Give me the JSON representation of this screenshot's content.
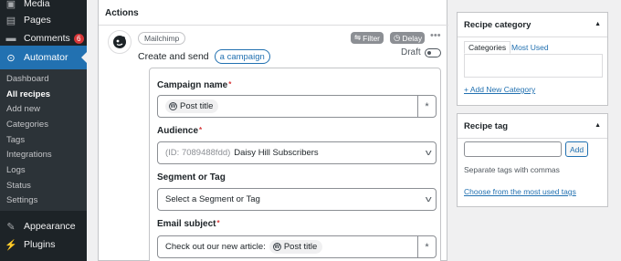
{
  "sidebar": {
    "top_items": [
      {
        "label": "Media",
        "icon": "media-icon"
      },
      {
        "label": "Pages",
        "icon": "pages-icon"
      },
      {
        "label": "Comments",
        "icon": "comments-icon",
        "badge": "6"
      },
      {
        "label": "Automator",
        "icon": "automator-icon",
        "active": true
      }
    ],
    "submenu": [
      "Dashboard",
      "All recipes",
      "Add new",
      "Categories",
      "Tags",
      "Integrations",
      "Logs",
      "Status",
      "Settings"
    ],
    "current_submenu": "All recipes",
    "bottom_items": [
      {
        "label": "Appearance",
        "icon": "appearance-icon"
      },
      {
        "label": "Plugins",
        "icon": "plugins-icon"
      }
    ]
  },
  "actions": {
    "title": "Actions",
    "integration": "Mailchimp",
    "filter_label": "Filter",
    "delay_label": "Delay",
    "sentence_text": "Create and send",
    "sentence_token": "a campaign",
    "status_label": "Draft",
    "fields": {
      "campaign_name": {
        "label": "Campaign name",
        "required": "*",
        "token": "Post title",
        "asterisk": "*"
      },
      "audience": {
        "label": "Audience",
        "required": "*",
        "id_text": "(ID: 7089488fdd)",
        "value": "Daisy Hill Subscribers"
      },
      "segment": {
        "label": "Segment or Tag",
        "placeholder": "Select a Segment or Tag"
      },
      "email_subject": {
        "label": "Email subject",
        "required": "*",
        "prefix": "Check out our new article:",
        "token": "Post title",
        "asterisk": "*"
      }
    }
  },
  "category_box": {
    "title": "Recipe category",
    "tab_categories": "Categories",
    "tab_most_used": "Most Used",
    "add_new_link": "+ Add New Category"
  },
  "tag_box": {
    "title": "Recipe tag",
    "add_button": "Add",
    "hint": "Separate tags with commas",
    "choose_link": "Choose from the most used tags"
  },
  "colors": {
    "accent": "#2271b1",
    "sidebar_bg": "#1d2327",
    "badge": "#d63638"
  }
}
